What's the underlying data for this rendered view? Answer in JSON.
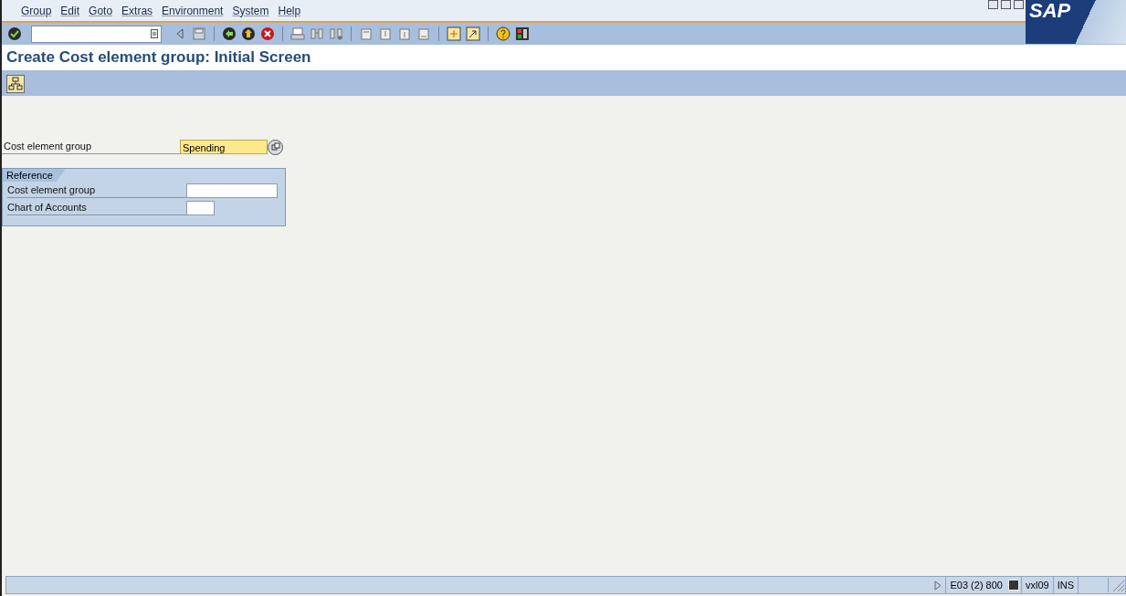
{
  "menu_bar": {
    "items": [
      "Group",
      "Edit",
      "Goto",
      "Extras",
      "Environment",
      "System",
      "Help"
    ]
  },
  "logo": {
    "text": "SAP"
  },
  "title": "Create Cost element group: Initial Screen",
  "form": {
    "field": {
      "label": "Cost element group",
      "value": "Spending"
    },
    "reference": {
      "title": "Reference",
      "fields": [
        {
          "label": "Cost element group"
        },
        {
          "label": "Chart of Accounts"
        }
      ]
    }
  },
  "status_bar": {
    "system": "E03 (2) 800",
    "server": "vxl09",
    "mode": "INS"
  }
}
